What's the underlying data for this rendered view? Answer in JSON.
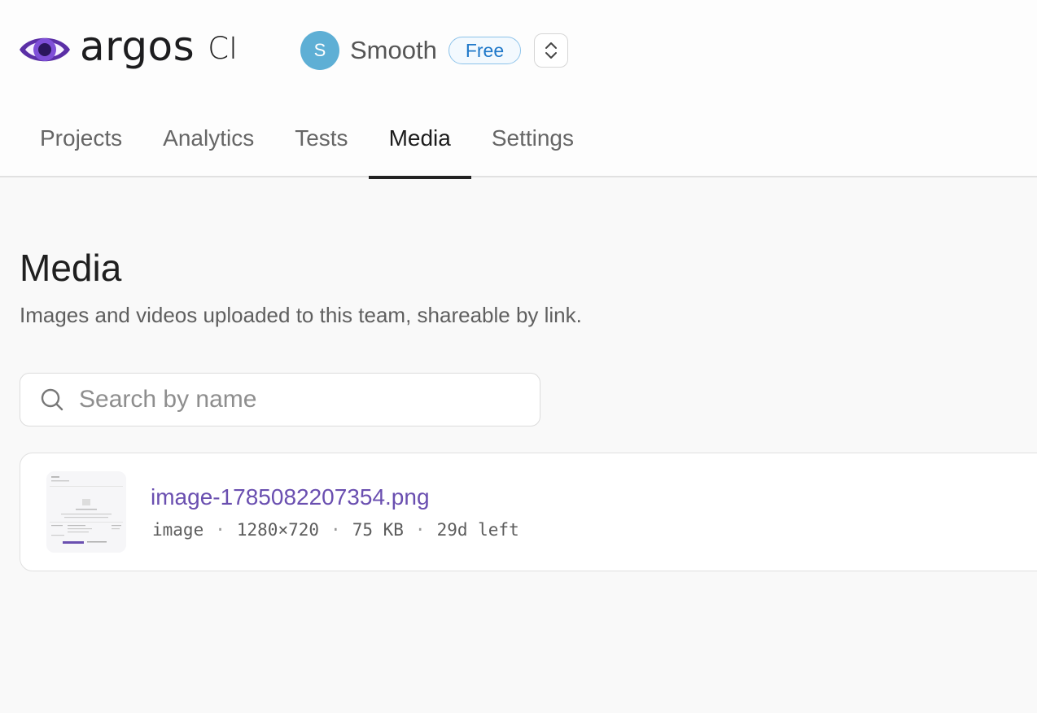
{
  "brand": {
    "logo_word": "argos",
    "logo_suffix": "CI",
    "colors": {
      "eye_outer": "#5b2fa6",
      "eye_iris": "#7f4fd8",
      "eye_pupil": "#2b165d"
    }
  },
  "team": {
    "avatar_initial": "S",
    "name": "Smooth",
    "plan": "Free",
    "switcher_icon": "chevron-up-down-icon"
  },
  "tabs": [
    {
      "label": "Projects",
      "active": false
    },
    {
      "label": "Analytics",
      "active": false
    },
    {
      "label": "Tests",
      "active": false
    },
    {
      "label": "Media",
      "active": true
    },
    {
      "label": "Settings",
      "active": false
    }
  ],
  "page": {
    "title": "Media",
    "subtitle": "Images and videos uploaded to this team, shareable by link."
  },
  "search": {
    "placeholder": "Search by name",
    "value": "",
    "icon": "search-icon"
  },
  "media_items": [
    {
      "name": "image-1785082207354.png",
      "type": "image",
      "dimensions": "1280×720",
      "size": "75 KB",
      "expires": "29d left"
    }
  ]
}
